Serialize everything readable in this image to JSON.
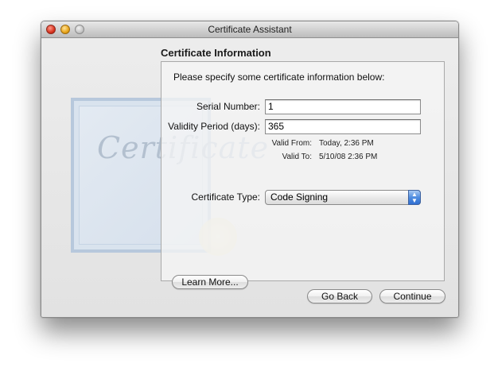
{
  "window": {
    "title": "Certificate Assistant"
  },
  "section": {
    "title": "Certificate Information",
    "intro": "Please specify some certificate information below:"
  },
  "form": {
    "serial_label": "Serial Number:",
    "serial_value": "1",
    "validity_label": "Validity Period (days):",
    "validity_value": "365",
    "valid_from_label": "Valid From:",
    "valid_from_value": "Today, 2:36 PM",
    "valid_to_label": "Valid To:",
    "valid_to_value": "5/10/08 2:36 PM",
    "type_label": "Certificate Type:",
    "type_value": "Code Signing"
  },
  "art": {
    "certificate_word": "Certificate"
  },
  "buttons": {
    "learn_more": "Learn More...",
    "go_back": "Go Back",
    "continue": "Continue"
  },
  "icons": {
    "close": "close-icon",
    "minimize": "minimize-icon",
    "zoom": "zoom-icon",
    "popup_arrows": "updown-arrows-icon"
  }
}
